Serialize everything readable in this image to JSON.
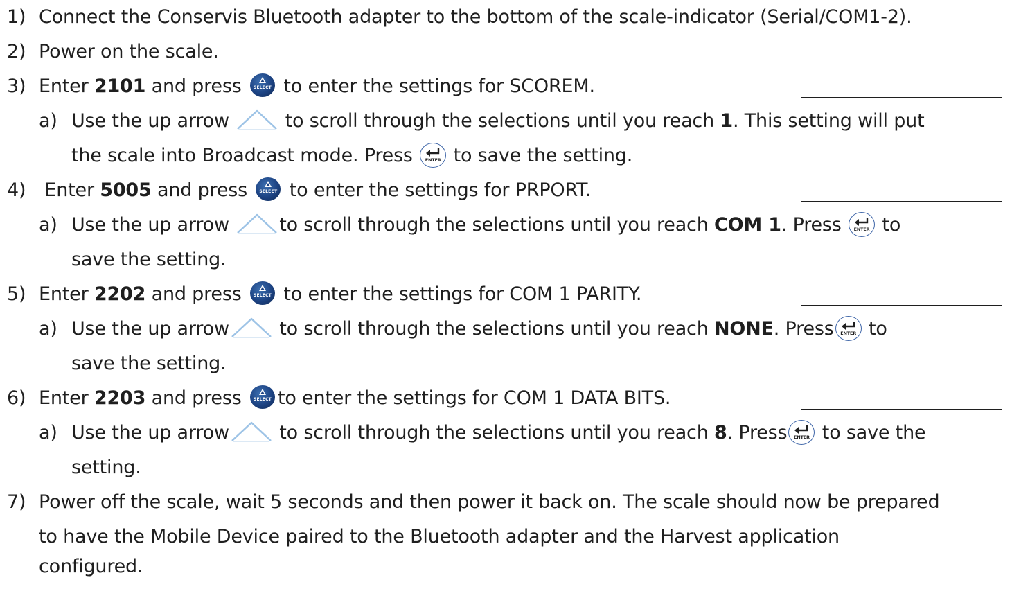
{
  "steps": {
    "s1": {
      "num": "1)",
      "text": "Connect the Conservis Bluetooth adapter to the bottom of the scale-indicator (Serial/COM1-2)."
    },
    "s2": {
      "num": "2)",
      "text": "Power on the scale."
    },
    "s3": {
      "num": "3)",
      "pre": "Enter ",
      "code": "2101",
      "mid": " and press ",
      "post": " to enter the settings for SCOREM.",
      "sub": {
        "label": "a)",
        "pre": "Use the up arrow ",
        "mid": " to scroll through the selections until you reach ",
        "value": "1",
        "post": ".   This setting will put",
        "cont_pre": "the scale into Broadcast mode.   Press ",
        "cont_post": " to save the setting."
      }
    },
    "s4": {
      "num": "4)",
      "pre": " Enter ",
      "code": "5005",
      "mid": " and press ",
      "post": " to enter the settings for PRPORT.",
      "sub": {
        "label": "a)",
        "pre": "Use the up arrow ",
        "mid": "to scroll through the selections until you reach ",
        "value": "COM 1",
        "post": ".  Press ",
        "tail": " to",
        "cont": "save the setting."
      }
    },
    "s5": {
      "num": "5)",
      "pre": "Enter ",
      "code": "2202",
      "mid": " and press ",
      "post": " to enter the settings for COM 1 PARITY.",
      "sub": {
        "label": "a)",
        "pre": "Use the up arrow",
        "mid": " to scroll through the selections until you reach ",
        "value": "NONE",
        "post": ".  Press",
        "tail": " to",
        "cont": "save the setting."
      }
    },
    "s6": {
      "num": "6)",
      "pre": "Enter ",
      "code": "2203",
      "mid": " and press ",
      "post": "to enter the settings for COM 1 DATA BITS.",
      "sub": {
        "label": "a)",
        "pre": "Use the up arrow",
        "mid": " to scroll through the selections until you reach ",
        "value": "8",
        "post": ".  Press",
        "tail": " to save the",
        "cont": "setting."
      }
    },
    "s7": {
      "num": "7)",
      "line1": "Power off the scale, wait 5 seconds and then power it back on.  The scale should now be prepared",
      "line2": "to have the Mobile Device paired to the Bluetooth adapter and the Harvest application",
      "line3": "configured."
    }
  },
  "icons": {
    "select_label": "SELECT",
    "enter_label": "ENTER",
    "select_color": "#1c4282",
    "enter_border_color": "#3f66a8",
    "arrow_color": "#9dc3e6"
  }
}
